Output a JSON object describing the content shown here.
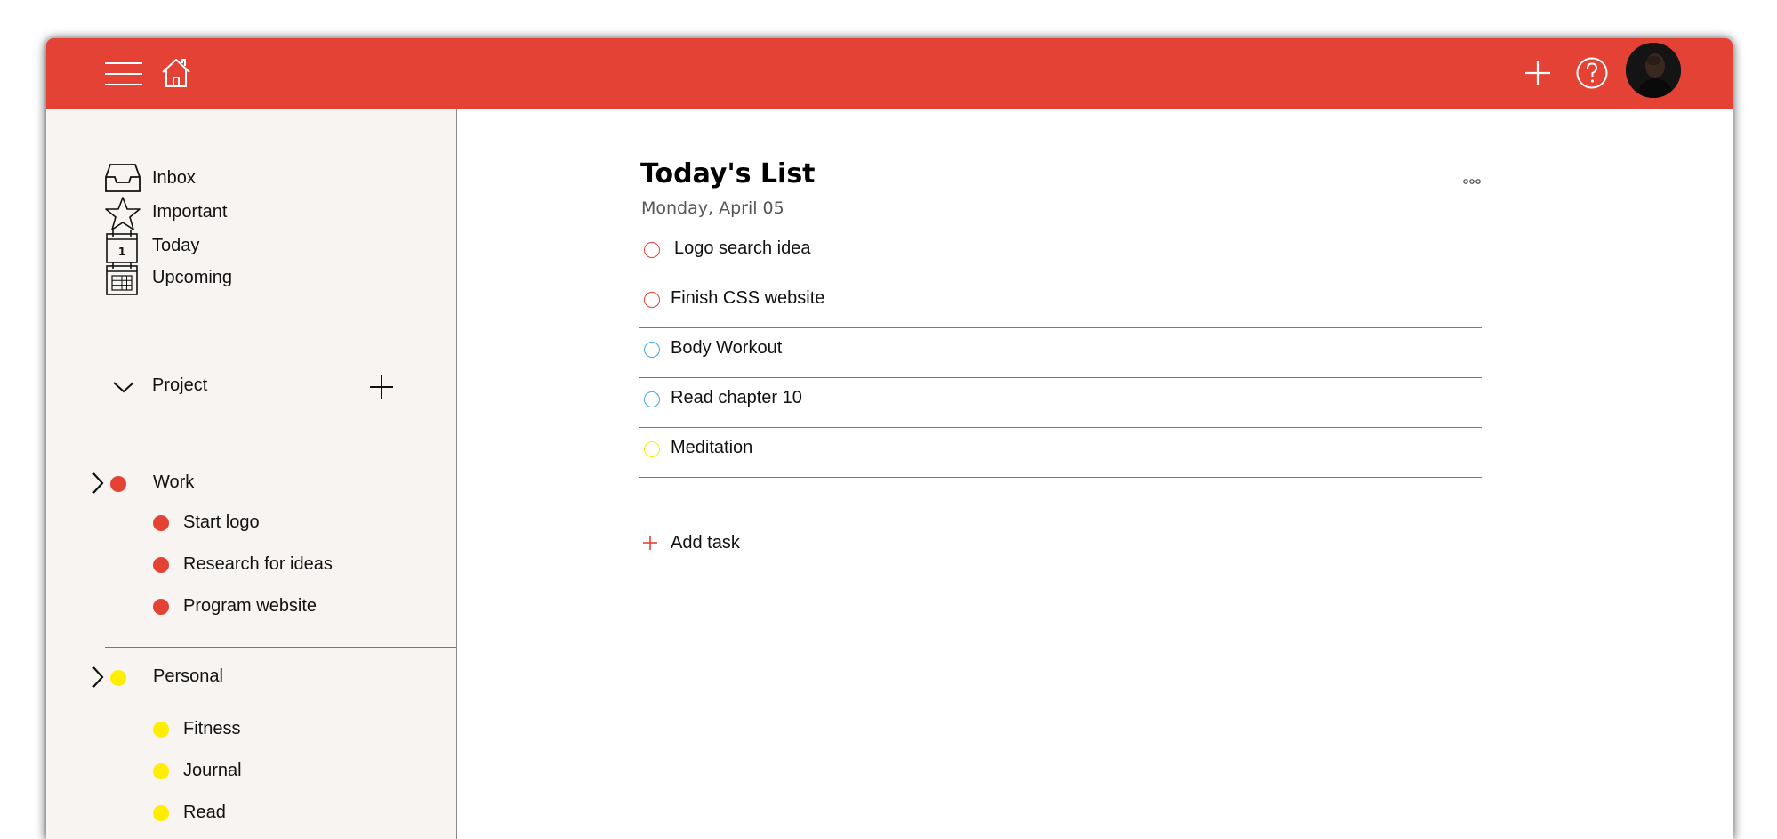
{
  "colors": {
    "accent": "#e34234",
    "work": "#e34234",
    "personal": "#ffee00",
    "sidebar_bg": "#f8f4f2",
    "task_red": "#e34234",
    "task_blue": "#3fa9f5",
    "task_yellow": "#ffee00"
  },
  "topbar": {
    "menu_icon": "hamburger-menu-icon",
    "home_icon": "home-icon",
    "add_icon": "plus-icon",
    "help_icon": "question-circle-icon",
    "avatar_icon": "user-avatar"
  },
  "sidebar": {
    "nav": [
      {
        "label": "Inbox",
        "icon": "inbox-tray-icon"
      },
      {
        "label": "Important",
        "icon": "star-icon"
      },
      {
        "label": "Today",
        "icon": "calendar-day-icon"
      },
      {
        "label": "Upcoming",
        "icon": "calendar-grid-icon"
      }
    ],
    "project_header": "Project",
    "groups": [
      {
        "label": "Work",
        "color": "#e34234",
        "items": [
          "Start logo",
          "Research for ideas",
          "Program website"
        ]
      },
      {
        "label": "Personal",
        "color": "#ffee00",
        "items": [
          "Fitness",
          "Journal",
          "Read"
        ]
      }
    ]
  },
  "main": {
    "title": "Today's List",
    "date": "Monday, April 05",
    "more_icon": "more-dots-icon",
    "tasks": [
      {
        "label": "Logo search idea",
        "color": "#e34234"
      },
      {
        "label": "Finish CSS website",
        "color": "#e34234"
      },
      {
        "label": "Body Workout",
        "color": "#3fa9f5"
      },
      {
        "label": "Read chapter 10",
        "color": "#3fa9f5"
      },
      {
        "label": "Meditation",
        "color": "#ffee00"
      }
    ],
    "add_task_label": "Add task"
  }
}
